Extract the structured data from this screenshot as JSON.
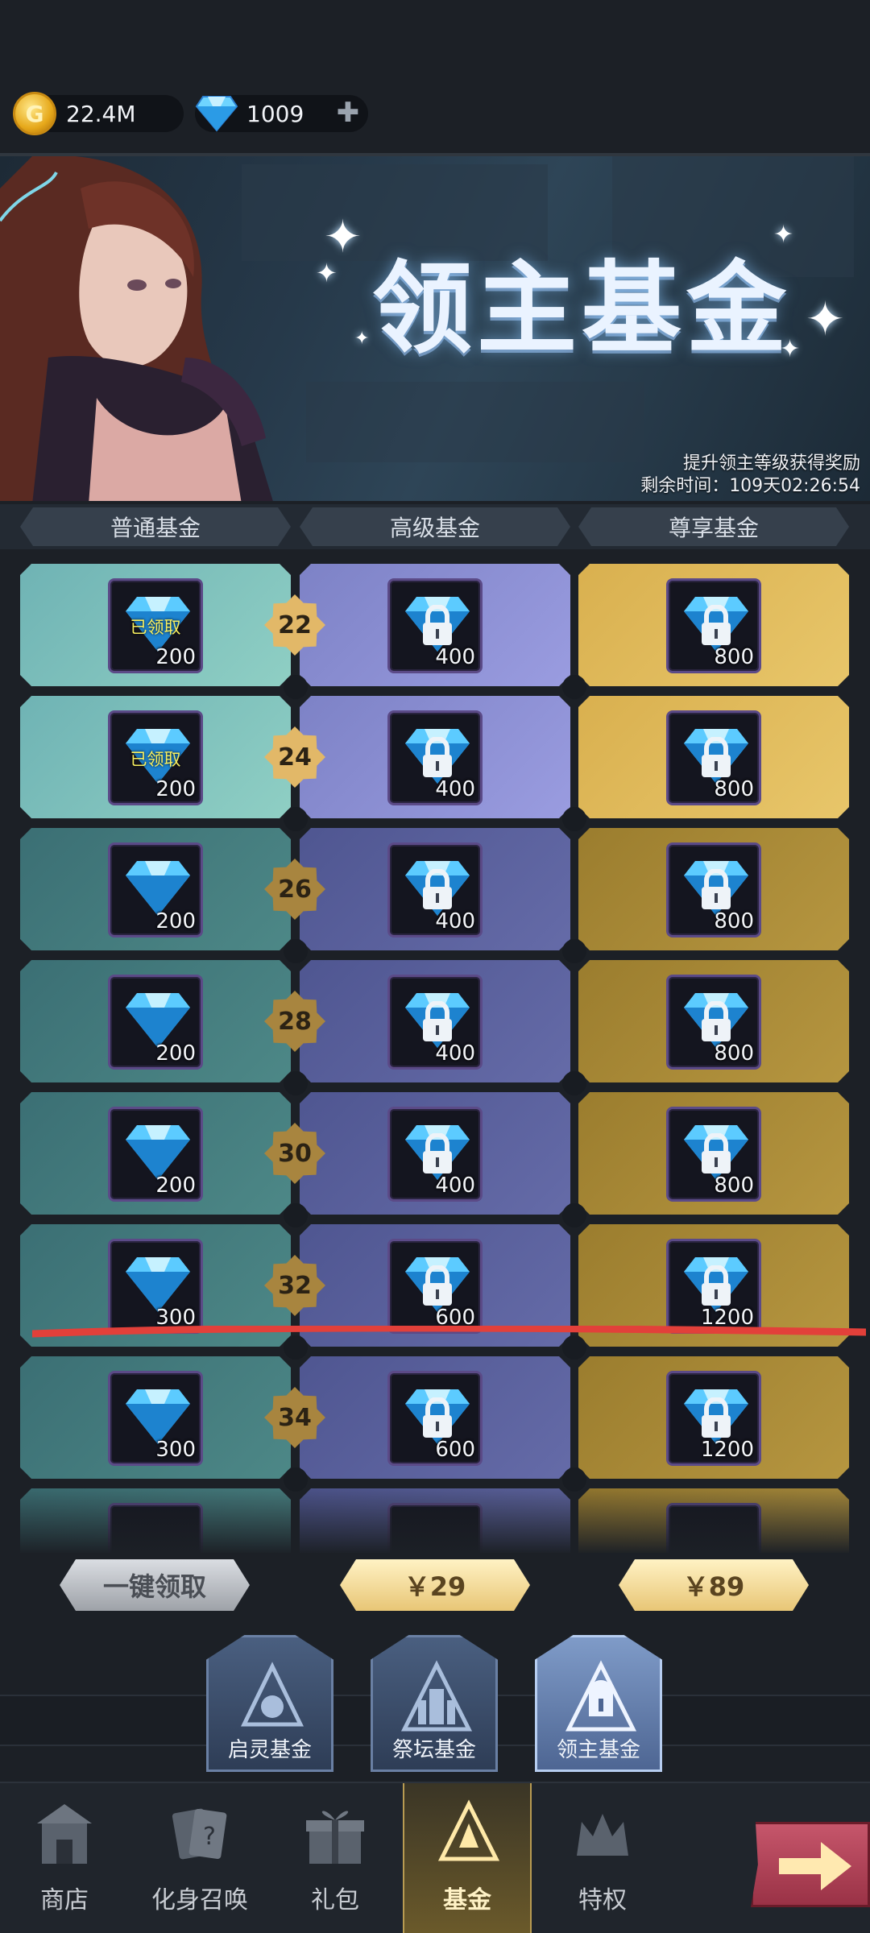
{
  "currency": {
    "gold": "22.4M",
    "gems": "1009"
  },
  "banner": {
    "title": "领主基金",
    "subtitle": "提升领主等级获得奖励",
    "remaining": "剩余时间：109天02:26:54"
  },
  "columns": [
    "普通基金",
    "高级基金",
    "尊享基金"
  ],
  "claimed_label": "已领取",
  "rows": [
    {
      "level": "22",
      "normal": "200",
      "advanced": "400",
      "premium": "800"
    },
    {
      "level": "24",
      "normal": "200",
      "advanced": "400",
      "premium": "800"
    },
    {
      "level": "26",
      "normal": "200",
      "advanced": "400",
      "premium": "800"
    },
    {
      "level": "28",
      "normal": "200",
      "advanced": "400",
      "premium": "800"
    },
    {
      "level": "30",
      "normal": "200",
      "advanced": "400",
      "premium": "800"
    },
    {
      "level": "32",
      "normal": "300",
      "advanced": "600",
      "premium": "1200"
    },
    {
      "level": "34",
      "normal": "300",
      "advanced": "600",
      "premium": "1200"
    }
  ],
  "buttons": {
    "claim_all": "一键领取",
    "price_advanced": "￥29",
    "price_premium": "￥89"
  },
  "fund_tabs": [
    "启灵基金",
    "祭坛基金",
    "领主基金"
  ],
  "nav": [
    "商店",
    "化身召唤",
    "礼包",
    "基金",
    "特权"
  ],
  "colors": {
    "annotation_line": "#e2403a",
    "gold_accent": "#e8c676"
  }
}
